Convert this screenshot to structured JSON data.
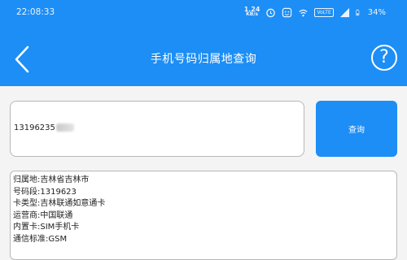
{
  "status_bar": {
    "time": "22:08:33",
    "net_speed_value": "1.24",
    "net_speed_unit": "KB/s",
    "volte": "VoLTE",
    "battery": "34%"
  },
  "header": {
    "title": "手机号码归属地查询",
    "help_symbol": "?"
  },
  "query": {
    "phone_value": "13196235",
    "button_label": "查询"
  },
  "result": {
    "lines": [
      "归属地:吉林省吉林市",
      "号码段:1319623",
      "卡类型:吉林联通如意通卡",
      "运营商:中国联通",
      "内置卡:SIM手机卡",
      "通信标准:GSM"
    ]
  },
  "colors": {
    "accent": "#1c8ef6",
    "background": "#f4f4f4"
  },
  "icons": [
    "back-arrow-icon",
    "help-icon",
    "alarm-icon",
    "face-icon",
    "wifi-icon",
    "signal-icon",
    "battery-icon"
  ]
}
